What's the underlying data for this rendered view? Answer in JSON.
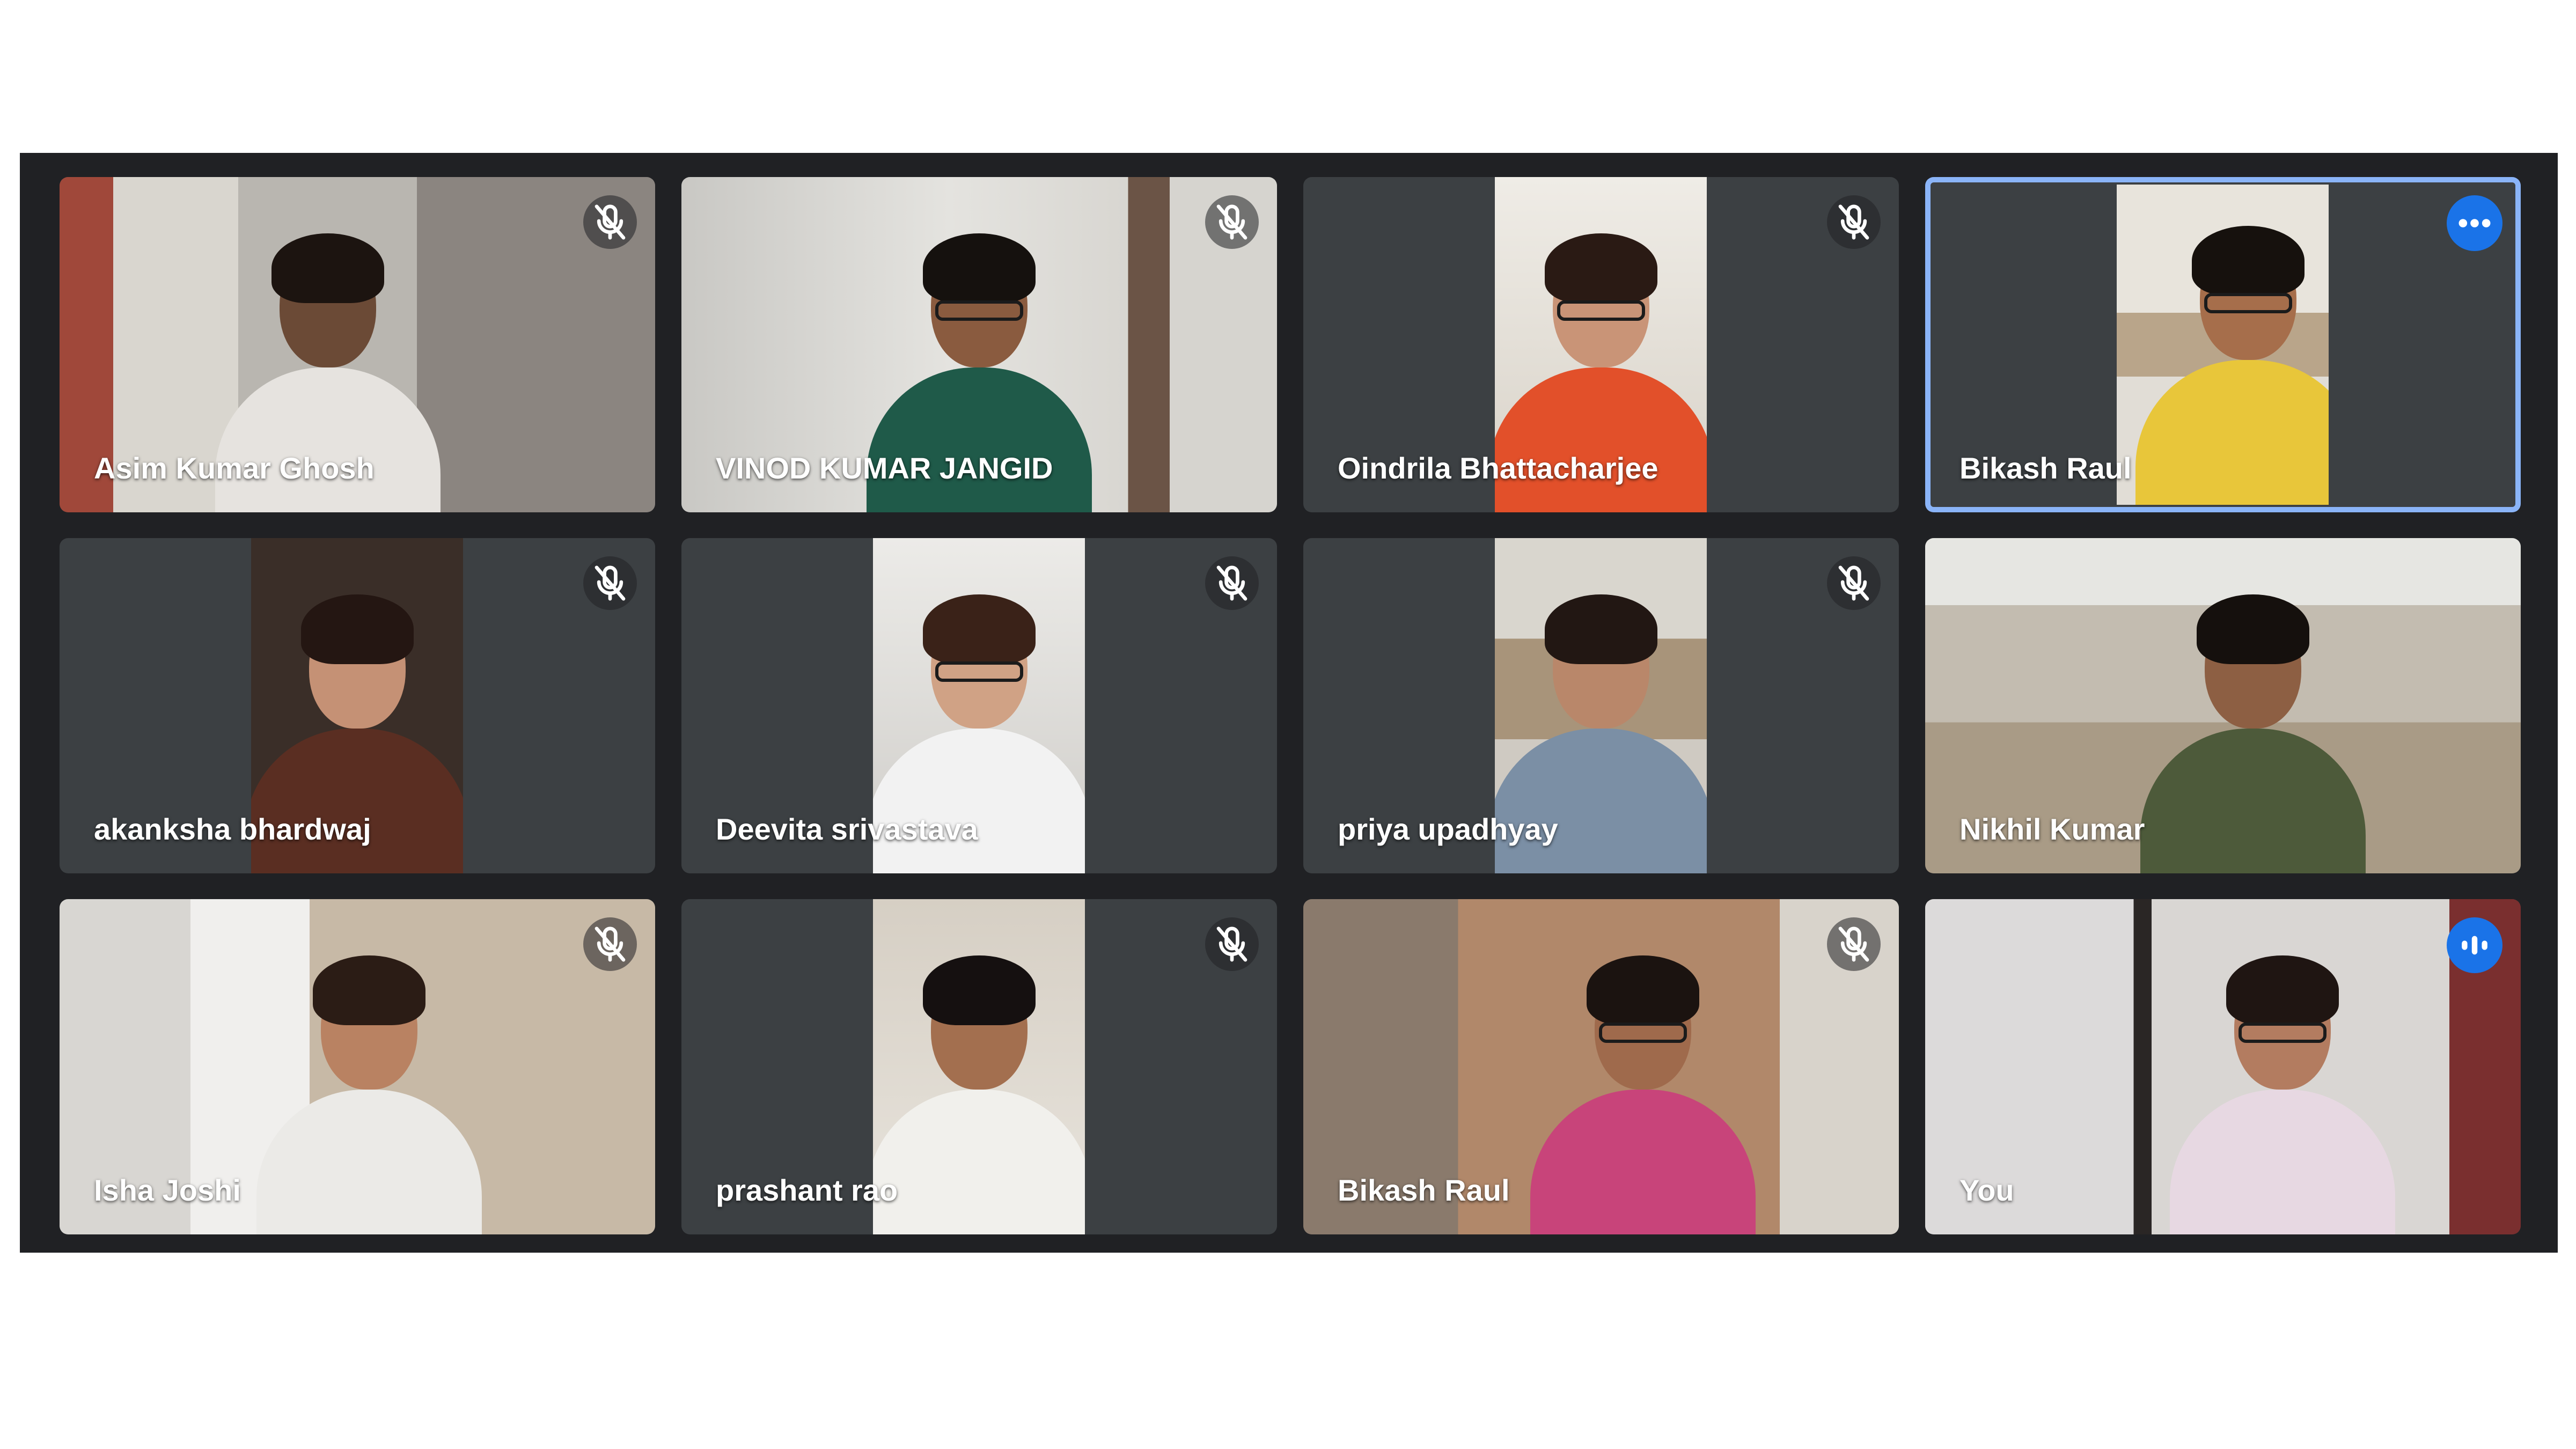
{
  "colors": {
    "window_bg": "#202124",
    "tile_bg": "#3c4043",
    "active_speaker_border": "#8ab4f8",
    "badge_blue": "#1a73e8",
    "name_text": "#ffffff"
  },
  "participants": [
    {
      "name": "Asim Kumar Ghosh",
      "status_icon": "mic-off-icon"
    },
    {
      "name": "VINOD KUMAR JANGID",
      "status_icon": "mic-off-icon"
    },
    {
      "name": "Oindrila Bhattacharjee",
      "status_icon": "mic-off-icon"
    },
    {
      "name": "Bikash Raul",
      "status_icon": "more-options-icon",
      "active_speaker": true
    },
    {
      "name": "akanksha bhardwaj",
      "status_icon": "mic-off-icon"
    },
    {
      "name": "Deevita srivastava",
      "status_icon": "mic-off-icon"
    },
    {
      "name": "priya upadhyay",
      "status_icon": "mic-off-icon"
    },
    {
      "name": "Nikhil Kumar",
      "status_icon": "none"
    },
    {
      "name": "Isha Joshi",
      "status_icon": "mic-off-icon"
    },
    {
      "name": "prashant rao",
      "status_icon": "mic-off-icon"
    },
    {
      "name": "Bikash Raul",
      "status_icon": "mic-off-icon"
    },
    {
      "name": "You",
      "status_icon": "audio-level-icon"
    }
  ]
}
